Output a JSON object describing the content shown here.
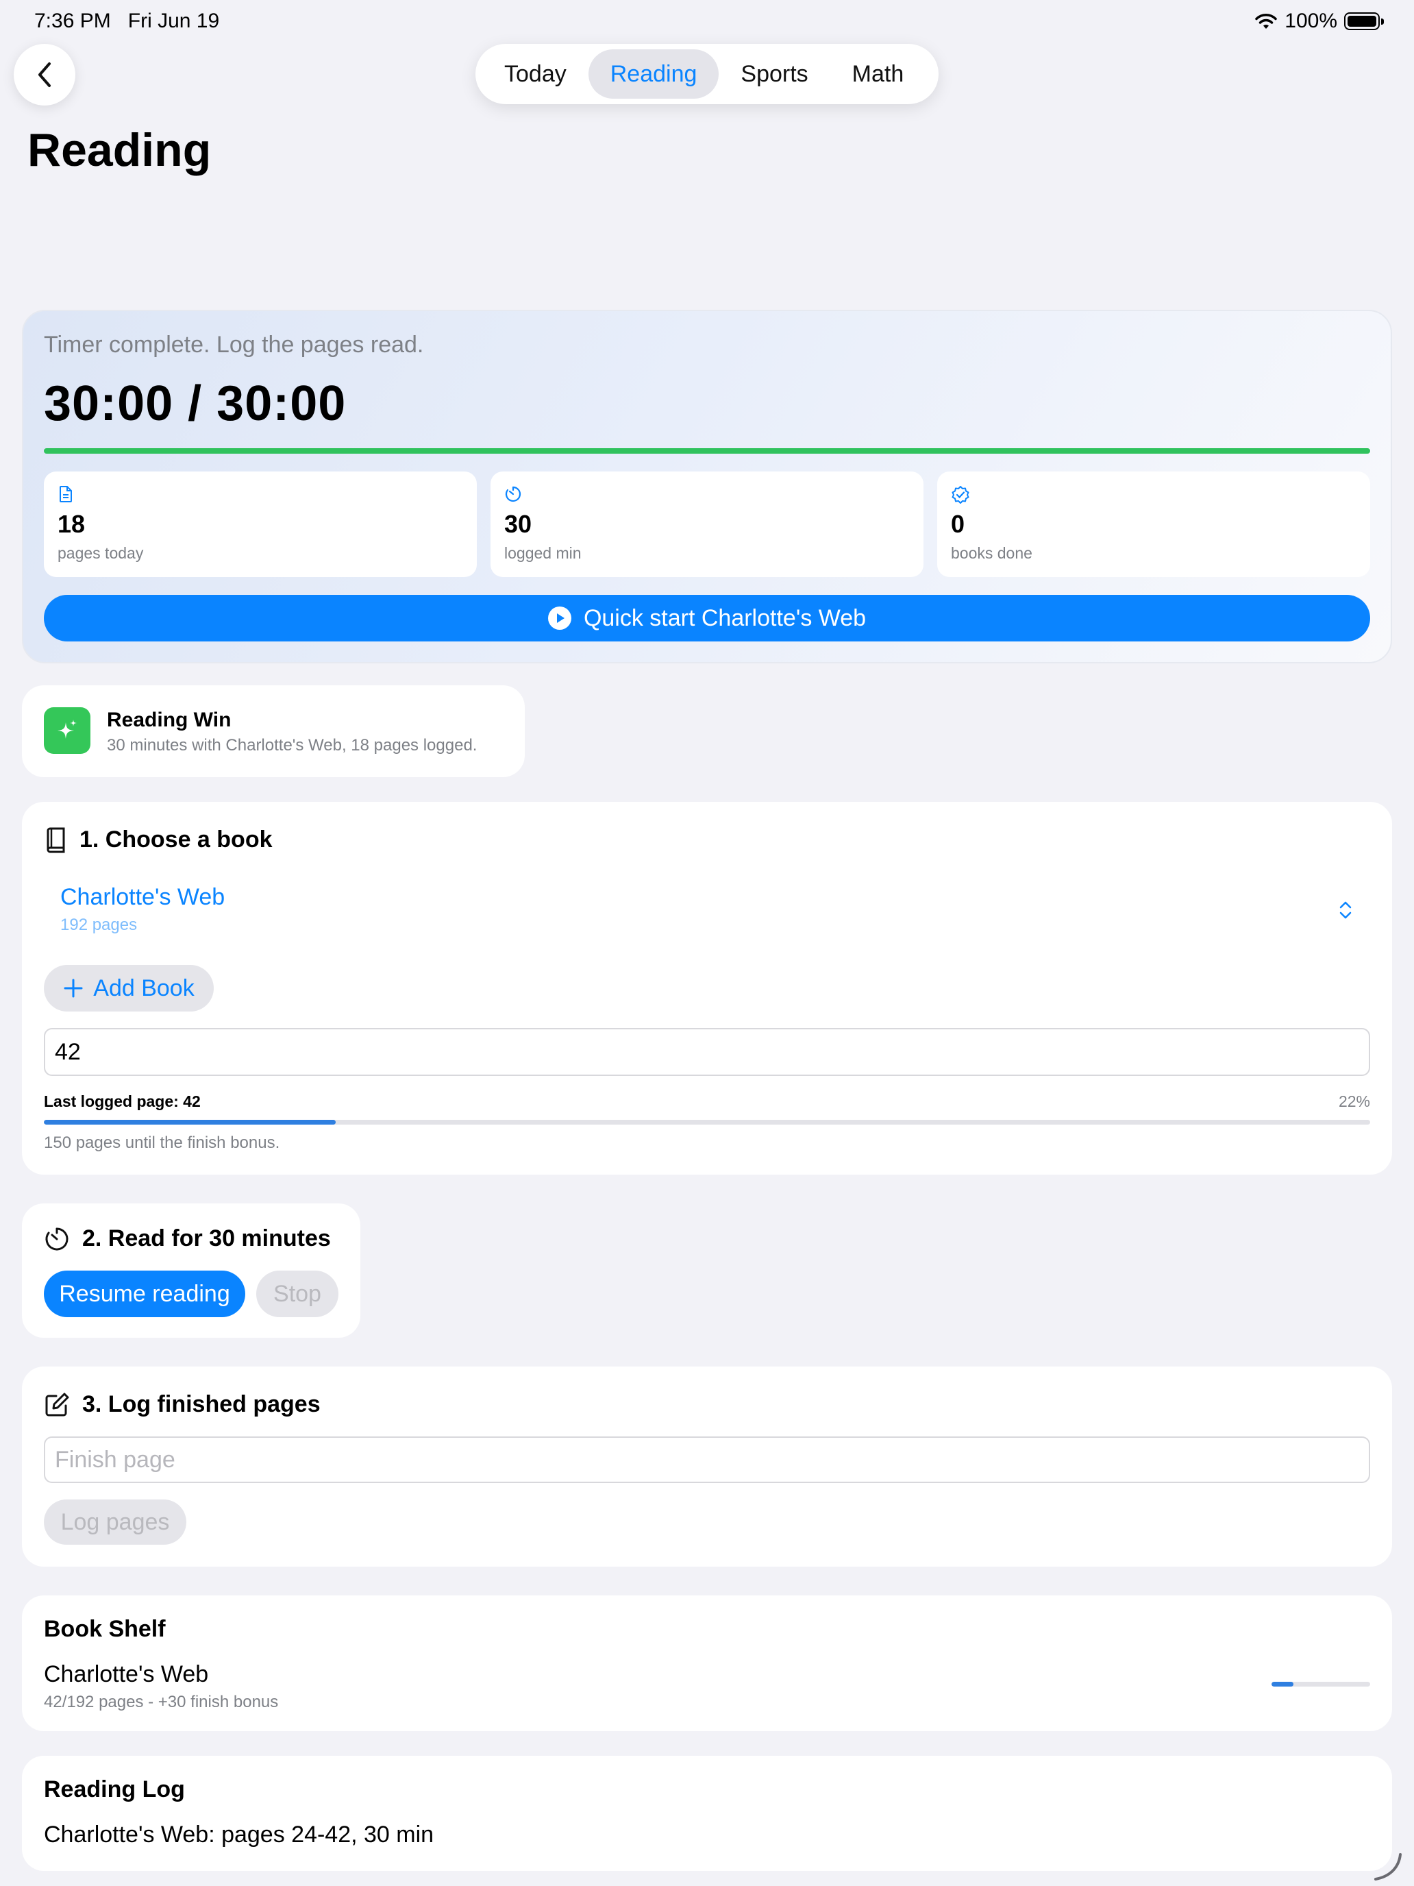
{
  "status_bar": {
    "time": "7:36 PM",
    "date": "Fri Jun 19",
    "battery": "100%"
  },
  "nav": {
    "back_icon": "chevron-left-icon",
    "tabs": [
      {
        "label": "Today",
        "active": false
      },
      {
        "label": "Reading",
        "active": true
      },
      {
        "label": "Sports",
        "active": false
      },
      {
        "label": "Math",
        "active": false
      }
    ]
  },
  "page_title": "Reading",
  "hero": {
    "subtitle": "Timer complete. Log the pages read.",
    "timer": "30:00 / 30:00",
    "timer_progress": 1.0,
    "stats": [
      {
        "value": "18",
        "label": "pages today",
        "icon": "document-icon"
      },
      {
        "value": "30",
        "label": "logged min",
        "icon": "timer-icon"
      },
      {
        "value": "0",
        "label": "books done",
        "icon": "checkmark-seal-icon"
      }
    ],
    "quick_start_label": "Quick start Charlotte's Web"
  },
  "win": {
    "title": "Reading Win",
    "text": "30 minutes with Charlotte's Web, 18 pages logged."
  },
  "choose_book": {
    "title": "1. Choose a book",
    "selected_book": "Charlotte's Web",
    "selected_pages": "192 pages",
    "add_book_label": "Add Book",
    "page_value": "42",
    "last_logged": "Last logged page: 42",
    "percent": "22%",
    "progress": 0.22,
    "finish_note": "150 pages until the finish bonus."
  },
  "read": {
    "title": "2. Read for 30 minutes",
    "resume_label": "Resume reading",
    "stop_label": "Stop"
  },
  "log": {
    "title": "3. Log finished pages",
    "finish_placeholder": "Finish page",
    "log_label": "Log pages"
  },
  "shelf": {
    "title": "Book Shelf",
    "book": "Charlotte's Web",
    "meta": "42/192 pages - +30 finish bonus",
    "progress": 0.22
  },
  "reading_log": {
    "title": "Reading Log",
    "entry": "Charlotte's Web: pages 24-42, 30 min"
  },
  "colors": {
    "accent": "#0a84ff",
    "success": "#34c759",
    "background": "#f2f2f7"
  }
}
